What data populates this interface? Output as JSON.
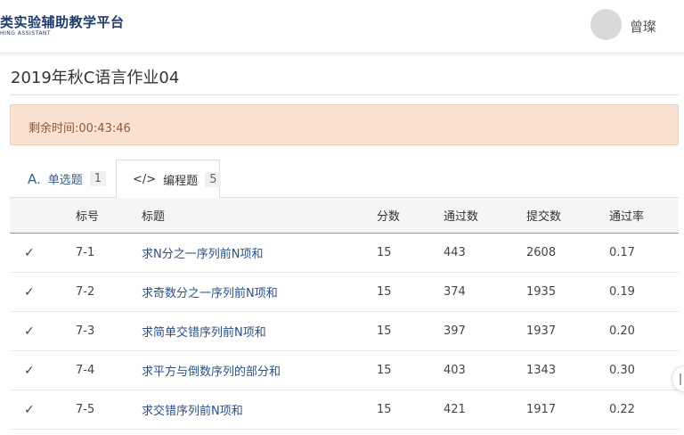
{
  "header": {
    "logo_title": "类实验辅助教学平台",
    "logo_subtitle": "HING ASSISTANT",
    "user_name": "曾璨"
  },
  "assignment": {
    "title": "2019年秋C语言作业04",
    "timer": "剩余时间:00:43:46"
  },
  "tabs": [
    {
      "icon": "A.",
      "label": "单选题",
      "count": "1"
    },
    {
      "icon": "</>",
      "label": "编程题",
      "count": "5"
    }
  ],
  "table": {
    "headers": {
      "number": "标号",
      "title": "标题",
      "score": "分数",
      "passed": "通过数",
      "submitted": "提交数",
      "rate": "通过率"
    },
    "rows": [
      {
        "number": "7-1",
        "title": "求N分之一序列前N项和",
        "score": "15",
        "passed": "443",
        "submitted": "2608",
        "rate": "0.17"
      },
      {
        "number": "7-2",
        "title": "求奇数分之一序列前N项和",
        "score": "15",
        "passed": "374",
        "submitted": "1935",
        "rate": "0.19"
      },
      {
        "number": "7-3",
        "title": "求简单交错序列前N项和",
        "score": "15",
        "passed": "397",
        "submitted": "1937",
        "rate": "0.20"
      },
      {
        "number": "7-4",
        "title": "求平方与倒数序列的部分和",
        "score": "15",
        "passed": "403",
        "submitted": "1343",
        "rate": "0.30"
      },
      {
        "number": "7-5",
        "title": "求交错序列前N项和",
        "score": "15",
        "passed": "421",
        "submitted": "1917",
        "rate": "0.22"
      }
    ]
  },
  "icons": {
    "solved": "check-icon",
    "side": "side-panel-handle"
  },
  "colors": {
    "check": "#e0443e",
    "timer_bg": "#fbe1d0",
    "link": "#2b4f86"
  }
}
